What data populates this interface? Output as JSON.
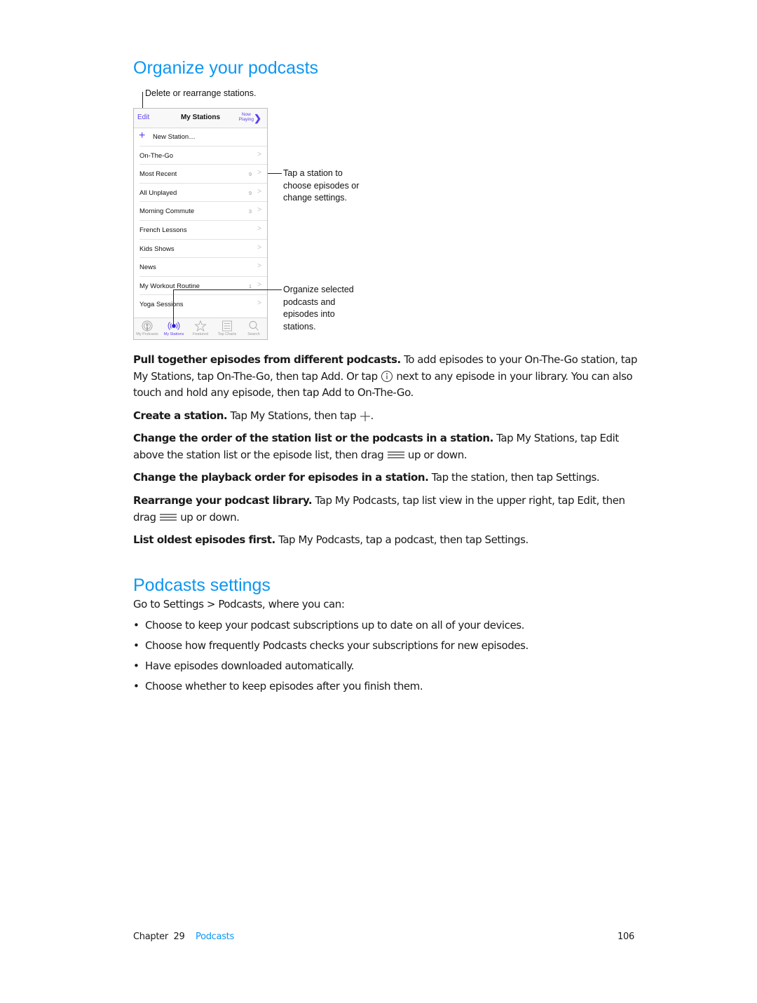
{
  "section1": {
    "title": "Organize your podcasts",
    "callouts": {
      "edit": "Delete or rearrange stations.",
      "tap_station": [
        "Tap a station to",
        "choose episodes or",
        "change settings."
      ],
      "organize": [
        "Organize selected",
        "podcasts and",
        "episodes into",
        "stations."
      ]
    },
    "phone": {
      "nav": {
        "edit": "Edit",
        "title": "My Stations",
        "now_playing_1": "Now",
        "now_playing_2": "Playing"
      },
      "new_station": "New Station…",
      "stations": [
        {
          "name": "On-The-Go",
          "count": ""
        },
        {
          "name": "Most Recent",
          "count": "9"
        },
        {
          "name": "All Unplayed",
          "count": "9"
        },
        {
          "name": "Morning Commute",
          "count": "3"
        },
        {
          "name": "French Lessons",
          "count": ""
        },
        {
          "name": "Kids Shows",
          "count": ""
        },
        {
          "name": "News",
          "count": ""
        },
        {
          "name": "My Workout Routine",
          "count": "1"
        },
        {
          "name": "Yoga Sessions",
          "count": ""
        }
      ],
      "tabs": [
        {
          "label": "My Podcasts",
          "icon": "podcast-icon"
        },
        {
          "label": "My Stations",
          "icon": "stations-icon",
          "active": true
        },
        {
          "label": "Featured",
          "icon": "star-icon"
        },
        {
          "label": "Top Charts",
          "icon": "list-icon"
        },
        {
          "label": "Search",
          "icon": "search-icon"
        }
      ],
      "accent": "#5b3ff0"
    },
    "paragraphs": [
      {
        "bold": "Pull together episodes from different podcasts.",
        "text1": " To add episodes to your On-The-Go station, tap My Stations, tap On-The-Go, then tap Add. Or tap ",
        "text2": " next to any episode in your library. You can also touch and hold any episode, then tap Add to On-The-Go."
      },
      {
        "bold": "Create a station.",
        "text1": " Tap My Stations, then tap ",
        "text2": "."
      },
      {
        "bold": "Change the order of the station list or the podcasts in a station.",
        "text1": " Tap My Stations, tap Edit above the station list or the episode list, then drag ",
        "text2": " up or down."
      },
      {
        "bold": "Change the playback order for episodes in a station.",
        "text1": " Tap the station, then tap Settings."
      },
      {
        "bold": "Rearrange your podcast library.",
        "text1": " Tap My Podcasts, tap list view in the upper right, tap Edit, then drag ",
        "text2": " up or down."
      },
      {
        "bold": "List oldest episodes first.",
        "text1": " Tap My Podcasts, tap a podcast, then tap Settings."
      }
    ]
  },
  "section2": {
    "title": "Podcasts settings",
    "intro": "Go to Settings > Podcasts, where you can:",
    "bullets": [
      "Choose to keep your podcast subscriptions up to date on all of your devices.",
      "Choose how frequently Podcasts checks your subscriptions for new episodes.",
      "Have episodes downloaded automatically.",
      "Choose whether to keep episodes after you finish them."
    ]
  },
  "footer": {
    "chapter": "Chapter  29",
    "chapter_name": "Podcasts",
    "page": "106"
  },
  "colors": {
    "heading": "#0d96f2",
    "text": "#1a1a1a"
  }
}
